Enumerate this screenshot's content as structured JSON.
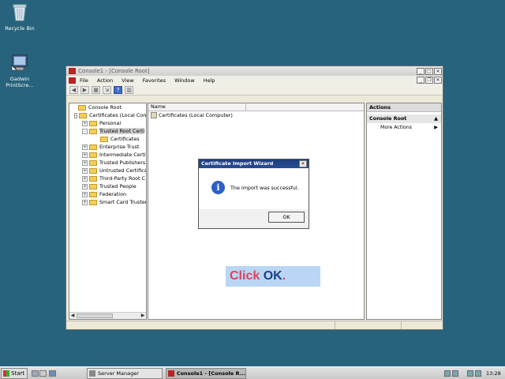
{
  "desktop": {
    "icons": [
      {
        "label": "Recycle Bin",
        "icon": "recycle-bin-icon"
      },
      {
        "label": "Gadwin PrintScre...",
        "icon": "gadwin-printscreen-icon"
      }
    ]
  },
  "window": {
    "title": "Console1 - [Console Root]",
    "menu": [
      "File",
      "Action",
      "View",
      "Favorites",
      "Window",
      "Help"
    ],
    "tree": [
      {
        "label": "Console Root",
        "expander": ""
      },
      {
        "label": "Certificates (Local Com",
        "expander": "-"
      },
      {
        "label": "Personal",
        "expander": "+"
      },
      {
        "label": "Trusted Root Certi",
        "expander": "-",
        "selected": true
      },
      {
        "label": "Certificates",
        "expander": ""
      },
      {
        "label": "Enterprise Trust",
        "expander": "+"
      },
      {
        "label": "Intermediate Certif",
        "expander": "+"
      },
      {
        "label": "Trusted Publishers",
        "expander": "+"
      },
      {
        "label": "Untrusted Certifica",
        "expander": "+"
      },
      {
        "label": "Third-Party Root C",
        "expander": "+"
      },
      {
        "label": "Trusted People",
        "expander": "+"
      },
      {
        "label": "Federation",
        "expander": "+"
      },
      {
        "label": "Smart Card Trusted",
        "expander": "+"
      }
    ],
    "content": {
      "column_name": "Name",
      "rows": [
        "Certificates (Local Computer)"
      ]
    },
    "actions": {
      "header": "Actions",
      "section": "Console Root",
      "item": "More Actions"
    }
  },
  "dialog": {
    "title": "Certificate Import Wizard",
    "message": "The import was successful.",
    "ok_label": "OK"
  },
  "callout": {
    "word1": "Click",
    "word2": "OK",
    "word3": "."
  },
  "taskbar": {
    "start_label": "Start",
    "tasks": [
      "Server Manager",
      "Console1 - [Console R..."
    ],
    "clock": "13:28"
  }
}
